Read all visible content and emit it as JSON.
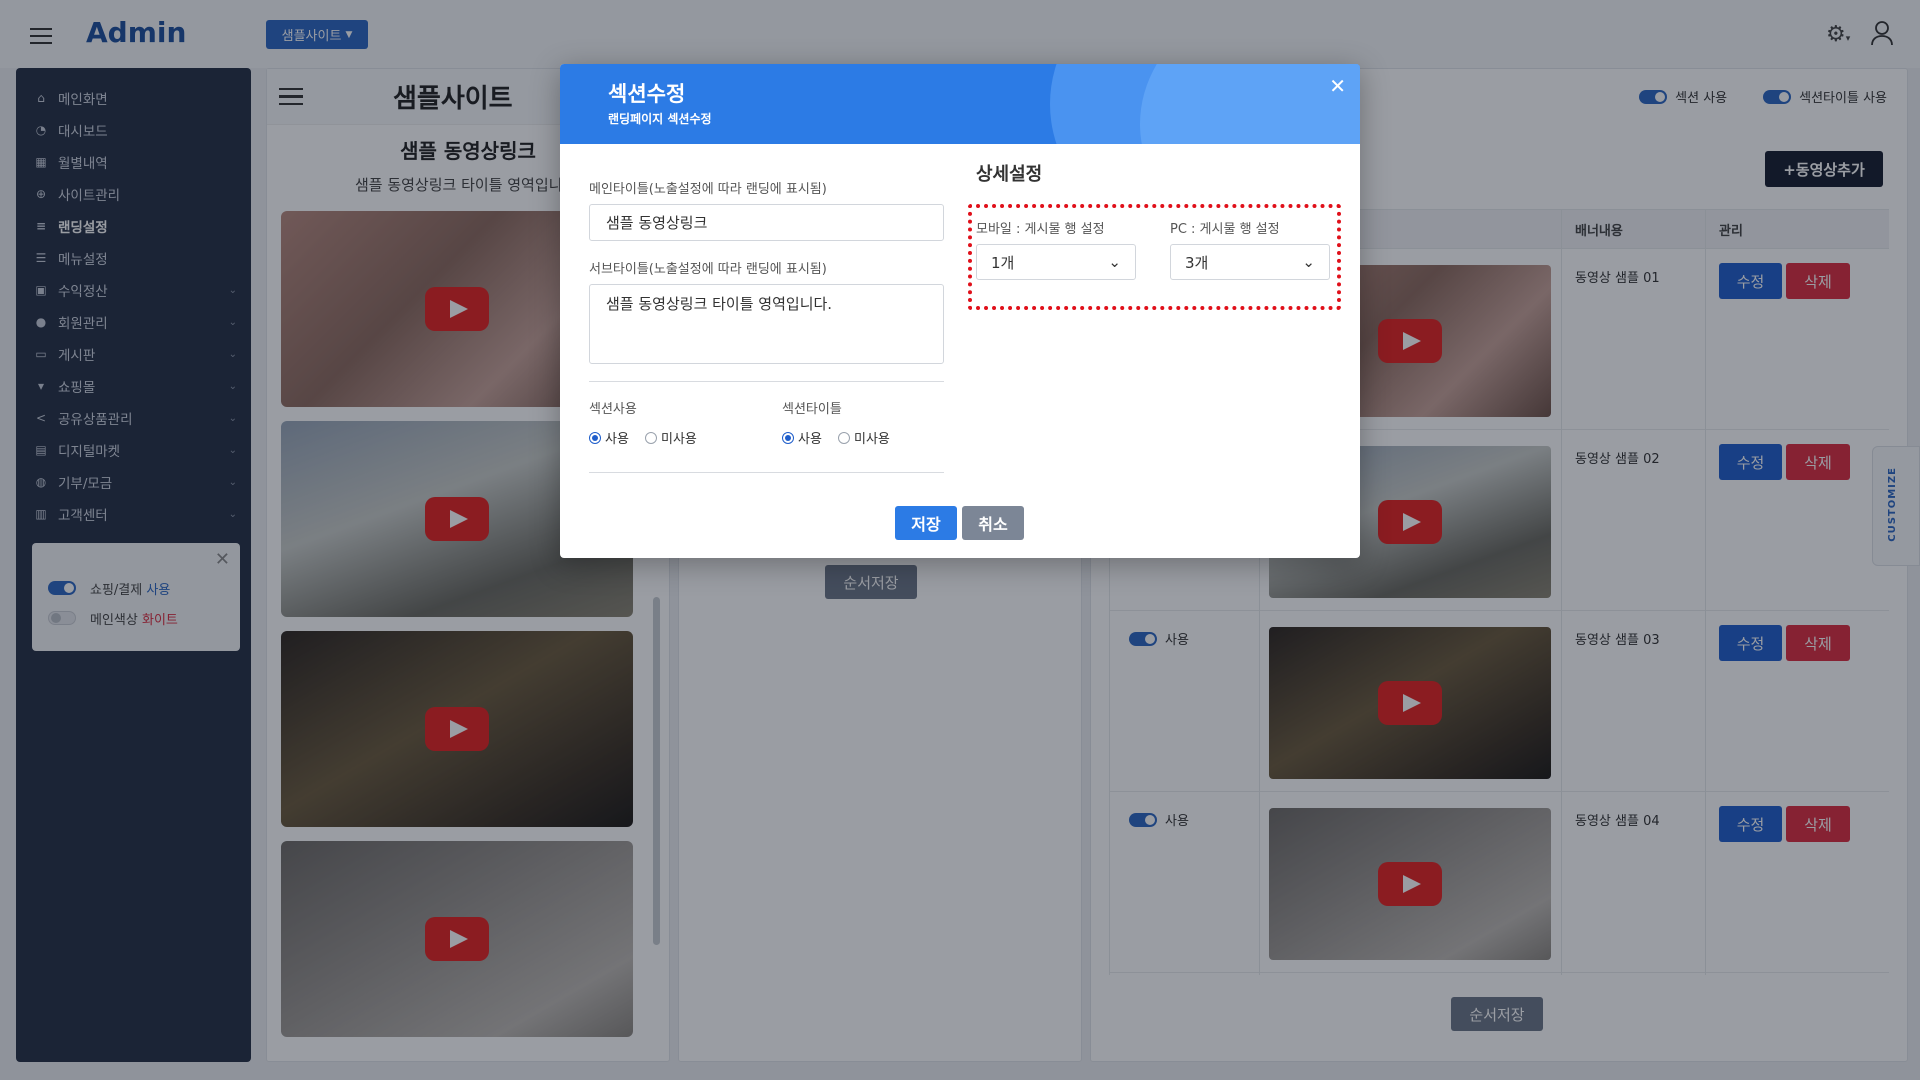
{
  "app": {
    "title": "Admin",
    "site_dropdown": "샘플사이트"
  },
  "sidebar": {
    "items": [
      {
        "label": "메인화면",
        "icon": "home-icon",
        "has_sub": false
      },
      {
        "label": "대시보드",
        "icon": "pie-chart-icon",
        "has_sub": false
      },
      {
        "label": "월별내역",
        "icon": "calendar-icon",
        "has_sub": false
      },
      {
        "label": "사이트관리",
        "icon": "globe-icon",
        "has_sub": false
      },
      {
        "label": "랜딩설정",
        "icon": "list-icon",
        "has_sub": false
      },
      {
        "label": "메뉴설정",
        "icon": "menu-list-icon",
        "has_sub": false
      },
      {
        "label": "수익정산",
        "icon": "lock-icon",
        "has_sub": true
      },
      {
        "label": "회원관리",
        "icon": "user-icon",
        "has_sub": true
      },
      {
        "label": "게시판",
        "icon": "clipboard-icon",
        "has_sub": true
      },
      {
        "label": "쇼핑몰",
        "icon": "cart-icon",
        "has_sub": true
      },
      {
        "label": "공유상품관리",
        "icon": "share-icon",
        "has_sub": true
      },
      {
        "label": "디지털마켓",
        "icon": "file-icon",
        "has_sub": true
      },
      {
        "label": "기부/모금",
        "icon": "coins-icon",
        "has_sub": true
      },
      {
        "label": "고객센터",
        "icon": "building-icon",
        "has_sub": true
      }
    ],
    "active_index": 4,
    "toggle_card": {
      "row1_prefix": "쇼핑/결제",
      "row1_value": "사용",
      "row2_prefix": "메인색상",
      "row2_value": "화이트"
    }
  },
  "preview": {
    "title": "샘플사이트",
    "section_title": "샘플 동영상링크",
    "section_subtitle": "샘플 동영상링크 타이틀 영역입니다."
  },
  "middle": {
    "order_save": "순서저장"
  },
  "list": {
    "toggle_section_use": "섹션 사용",
    "toggle_section_title_use": "섹션타이틀 사용",
    "add_video": "+동영상추가",
    "headers": {
      "banner_content": "배너내용",
      "manage": "관리"
    },
    "rows": [
      {
        "use_label": "",
        "banner": "동영상 샘플 01"
      },
      {
        "use_label": "",
        "banner": "동영상 샘플 02"
      },
      {
        "use_label": "사용",
        "banner": "동영상 샘플 03"
      },
      {
        "use_label": "사용",
        "banner": "동영상 샘플 04"
      }
    ],
    "edit_label": "수정",
    "delete_label": "삭제",
    "order_save": "순서저장"
  },
  "customize_tab": "CUSTOMIZE",
  "modal": {
    "title": "섹션수정",
    "subtitle": "랜딩페이지 섹션수정",
    "main_title_label": "메인타이틀(노출설정에 따라 랜딩에 표시됨)",
    "main_title_value": "샘플 동영상링크",
    "sub_title_label": "서브타이틀(노출설정에 따라 랜딩에 표시됨)",
    "sub_title_value": "샘플 동영상링크 타이틀 영역입니다.",
    "section_use_label": "섹션사용",
    "section_title_label": "섹션타이틀",
    "radio_use": "사용",
    "radio_unuse": "미사용",
    "detail_title": "상세설정",
    "mobile_label": "모바일 : 게시물 행 설정",
    "mobile_value": "1개",
    "pc_label": "PC : 게시물 행 설정",
    "pc_value": "3개",
    "save": "저장",
    "cancel": "취소"
  },
  "colors": {
    "primary": "#2c7be5",
    "danger": "#dc2c3f",
    "sidebar": "#252f44",
    "highlight": "#e0101a"
  }
}
